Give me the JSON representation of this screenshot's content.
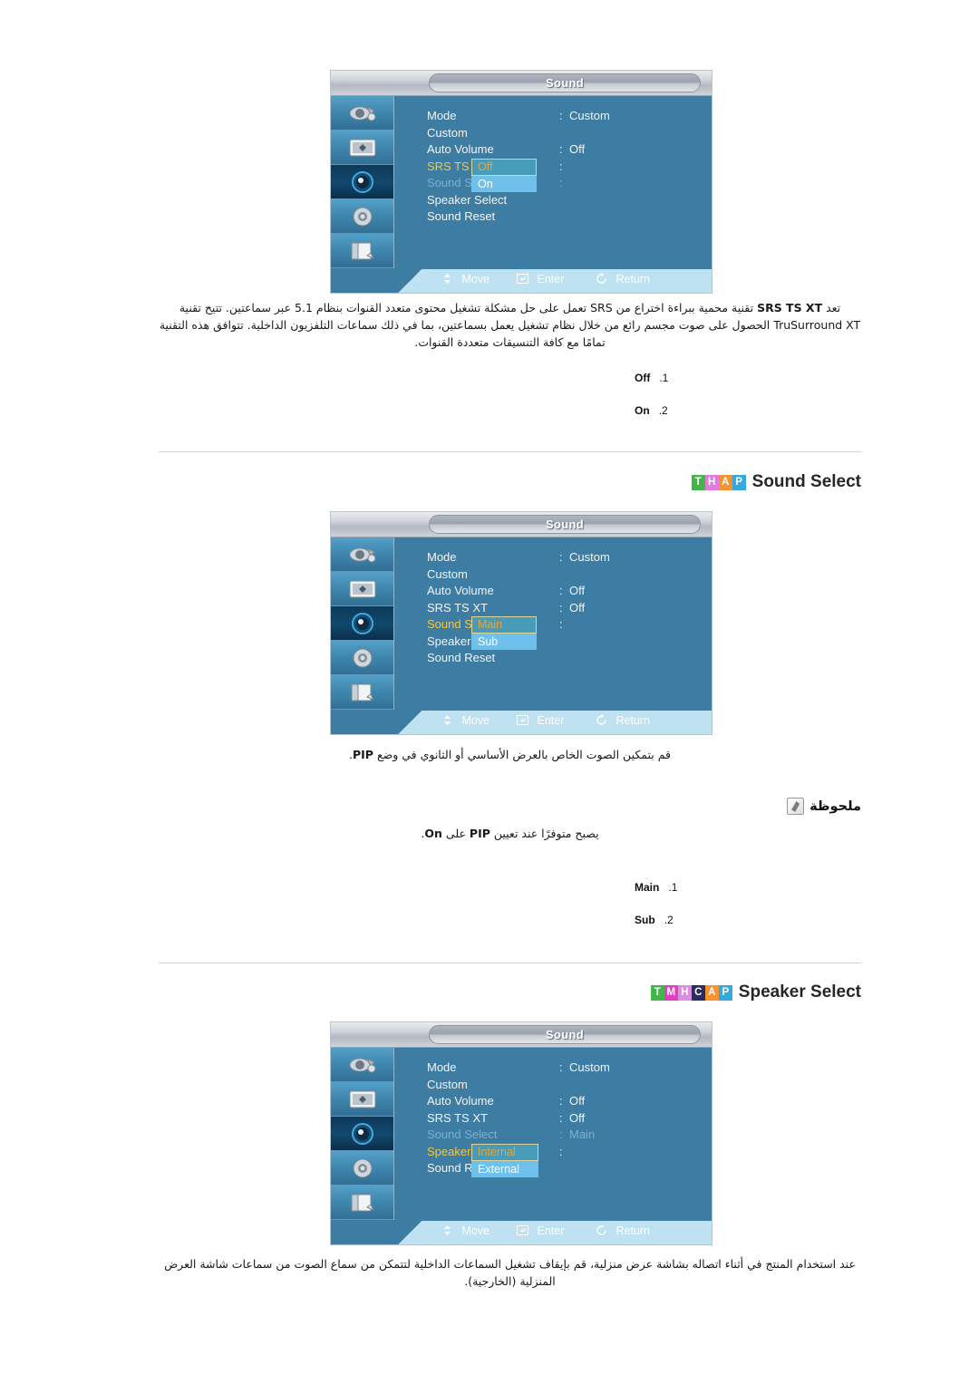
{
  "osd_common": {
    "title": "Sound",
    "rows": [
      {
        "label": "Mode",
        "value": "Custom",
        "colon": ":"
      },
      {
        "label": "Custom",
        "value": "",
        "colon": ""
      },
      {
        "label": "Auto Volume",
        "value": "Off",
        "colon": ":"
      },
      {
        "label": "SRS TS XT",
        "value": "Off",
        "colon": ":"
      },
      {
        "label": "Sound Select",
        "value": "Main",
        "colon": ":"
      },
      {
        "label": "Speaker Select",
        "value": "",
        "colon": ""
      },
      {
        "label": "Sound Reset",
        "value": "",
        "colon": ""
      }
    ],
    "footer": {
      "move": "Move",
      "enter": "Enter",
      "return": "Return"
    },
    "rail_icons": [
      "picture-camera-icon",
      "display-screen-icon",
      "speaker-sound-icon",
      "setup-gear-icon",
      "multi-control-pages-icon"
    ],
    "selected_rail_index": 2
  },
  "osd_srs": {
    "active_row_index": 3,
    "dim_row_indexes": [
      4
    ],
    "rows": [
      {
        "label": "Mode",
        "value": "Custom",
        "colon": ":"
      },
      {
        "label": "Custom",
        "value": "",
        "colon": ""
      },
      {
        "label": "Auto Volume",
        "value": "Off",
        "colon": ":"
      },
      {
        "label": "SRS TS XT",
        "value": "",
        "colon": ":"
      },
      {
        "label": "Sound Select",
        "value": "",
        "colon": ":"
      },
      {
        "label": "Speaker Select",
        "value": "",
        "colon": ""
      },
      {
        "label": "Sound Reset",
        "value": "",
        "colon": ""
      }
    ],
    "options": [
      {
        "label": "Off",
        "selected": true
      },
      {
        "label": "On",
        "selected": false
      }
    ]
  },
  "osd_sound_select": {
    "active_row_index": 4,
    "dim_row_indexes": [],
    "rows": [
      {
        "label": "Mode",
        "value": "Custom",
        "colon": ":"
      },
      {
        "label": "Custom",
        "value": "",
        "colon": ""
      },
      {
        "label": "Auto Volume",
        "value": "Off",
        "colon": ":"
      },
      {
        "label": "SRS TS XT",
        "value": "Off",
        "colon": ":"
      },
      {
        "label": "Sound Select",
        "value": "",
        "colon": ":"
      },
      {
        "label": "Speaker Select",
        "value": "",
        "colon": ""
      },
      {
        "label": "Sound Reset",
        "value": "",
        "colon": ""
      }
    ],
    "options": [
      {
        "label": "Main",
        "selected": true
      },
      {
        "label": "Sub",
        "selected": false
      }
    ]
  },
  "osd_speaker_select": {
    "active_row_index": 5,
    "dim_row_indexes": [
      4
    ],
    "rows": [
      {
        "label": "Mode",
        "value": "Custom",
        "colon": ":"
      },
      {
        "label": "Custom",
        "value": "",
        "colon": ""
      },
      {
        "label": "Auto Volume",
        "value": "Off",
        "colon": ":"
      },
      {
        "label": "SRS TS XT",
        "value": "Off",
        "colon": ":"
      },
      {
        "label": "Sound Select",
        "value": "Main",
        "colon": ":"
      },
      {
        "label": "Speaker Select",
        "value": "",
        "colon": ":"
      },
      {
        "label": "Sound Reset",
        "value": "",
        "colon": ""
      }
    ],
    "options": [
      {
        "label": "Internal",
        "selected": true
      },
      {
        "label": "External",
        "selected": false
      }
    ]
  },
  "srs_section": {
    "paragraph": "تعد SRS TS XT تقنية محمية ببراءة اختراع من SRS تعمل على حل مشكلة تشغيل محتوى متعدد القنوات بنظام 5.1 عبر سماعتين. تتيح تقنية TruSurround XT الحصول على صوت مجسم رائع من خلال نظام تشغيل يعمل بسماعتين، بما في ذلك سماعات التلفزيون الداخلية. تتوافق هذه التقنية تمامًا مع كافة التنسيقات متعددة القنوات.",
    "para_bold_token": "SRS TS XT",
    "items": [
      {
        "index": ".1",
        "label": "Off"
      },
      {
        "index": ".2",
        "label": "On"
      }
    ]
  },
  "sound_select_section": {
    "badges": [
      {
        "letter": "T",
        "color": "#43b649"
      },
      {
        "letter": "H",
        "color": "#e07ce0"
      },
      {
        "letter": "A",
        "color": "#f7922f"
      },
      {
        "letter": "P",
        "color": "#36a8dd"
      }
    ],
    "title": "Sound Select",
    "paragraph": "قم بتمكين الصوت الخاص بالعرض الأساسي أو الثانوي في وضع PIP.",
    "note": {
      "title": "ملحوظة",
      "icon": "note-pencil-icon",
      "body": "يصبح متوفرًا عند تعيين PIP على On."
    },
    "items": [
      {
        "index": ".1",
        "label": "Main"
      },
      {
        "index": ".2",
        "label": "Sub"
      }
    ]
  },
  "speaker_select_section": {
    "badges": [
      {
        "letter": "T",
        "color": "#43b649"
      },
      {
        "letter": "M",
        "color": "#e040c0"
      },
      {
        "letter": "H",
        "color": "#d98fe0"
      },
      {
        "letter": "C",
        "color": "#2b2b5e"
      },
      {
        "letter": "A",
        "color": "#f7922f"
      },
      {
        "letter": "P",
        "color": "#36a8dd"
      }
    ],
    "title": "Speaker Select",
    "paragraph": "عند استخدام المنتج في أثناء اتصاله بشاشة عرض منزلية، قم بإيقاف تشغيل السماعات الداخلية لتتمكن من سماع الصوت من سماعات شاشة العرض المنزلية (الخارجية)."
  }
}
